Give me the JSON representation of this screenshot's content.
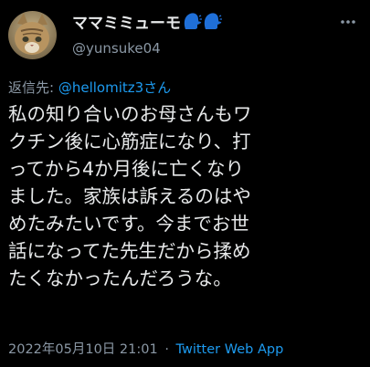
{
  "author": {
    "display_name": "ママミミューモ",
    "name_emoji": "speaking-head-emoji",
    "handle": "@yunsuke04"
  },
  "reply": {
    "prefix": "返信先:",
    "to": "@hellomitz3さん"
  },
  "tweet": {
    "lines": [
      "私の知り合いのお母さんもワ",
      "クチン後に心筋症になり、打",
      "ってから4か月後に亡くなり",
      "ました。家族は訴えるのはや",
      "めたみたいです。今までお世",
      "話になってた先生だから揉め",
      "たくなかったんだろうな。"
    ]
  },
  "meta": {
    "timestamp": "2022年05月10日 21:01",
    "separator": "·",
    "source": "Twitter Web App"
  },
  "icons": {
    "more": "more-options-icon",
    "avatar": "cat-avatar"
  },
  "colors": {
    "background": "#000000",
    "text": "#e7e9ea",
    "secondary": "#8b98a5",
    "link": "#1d9bf0"
  }
}
